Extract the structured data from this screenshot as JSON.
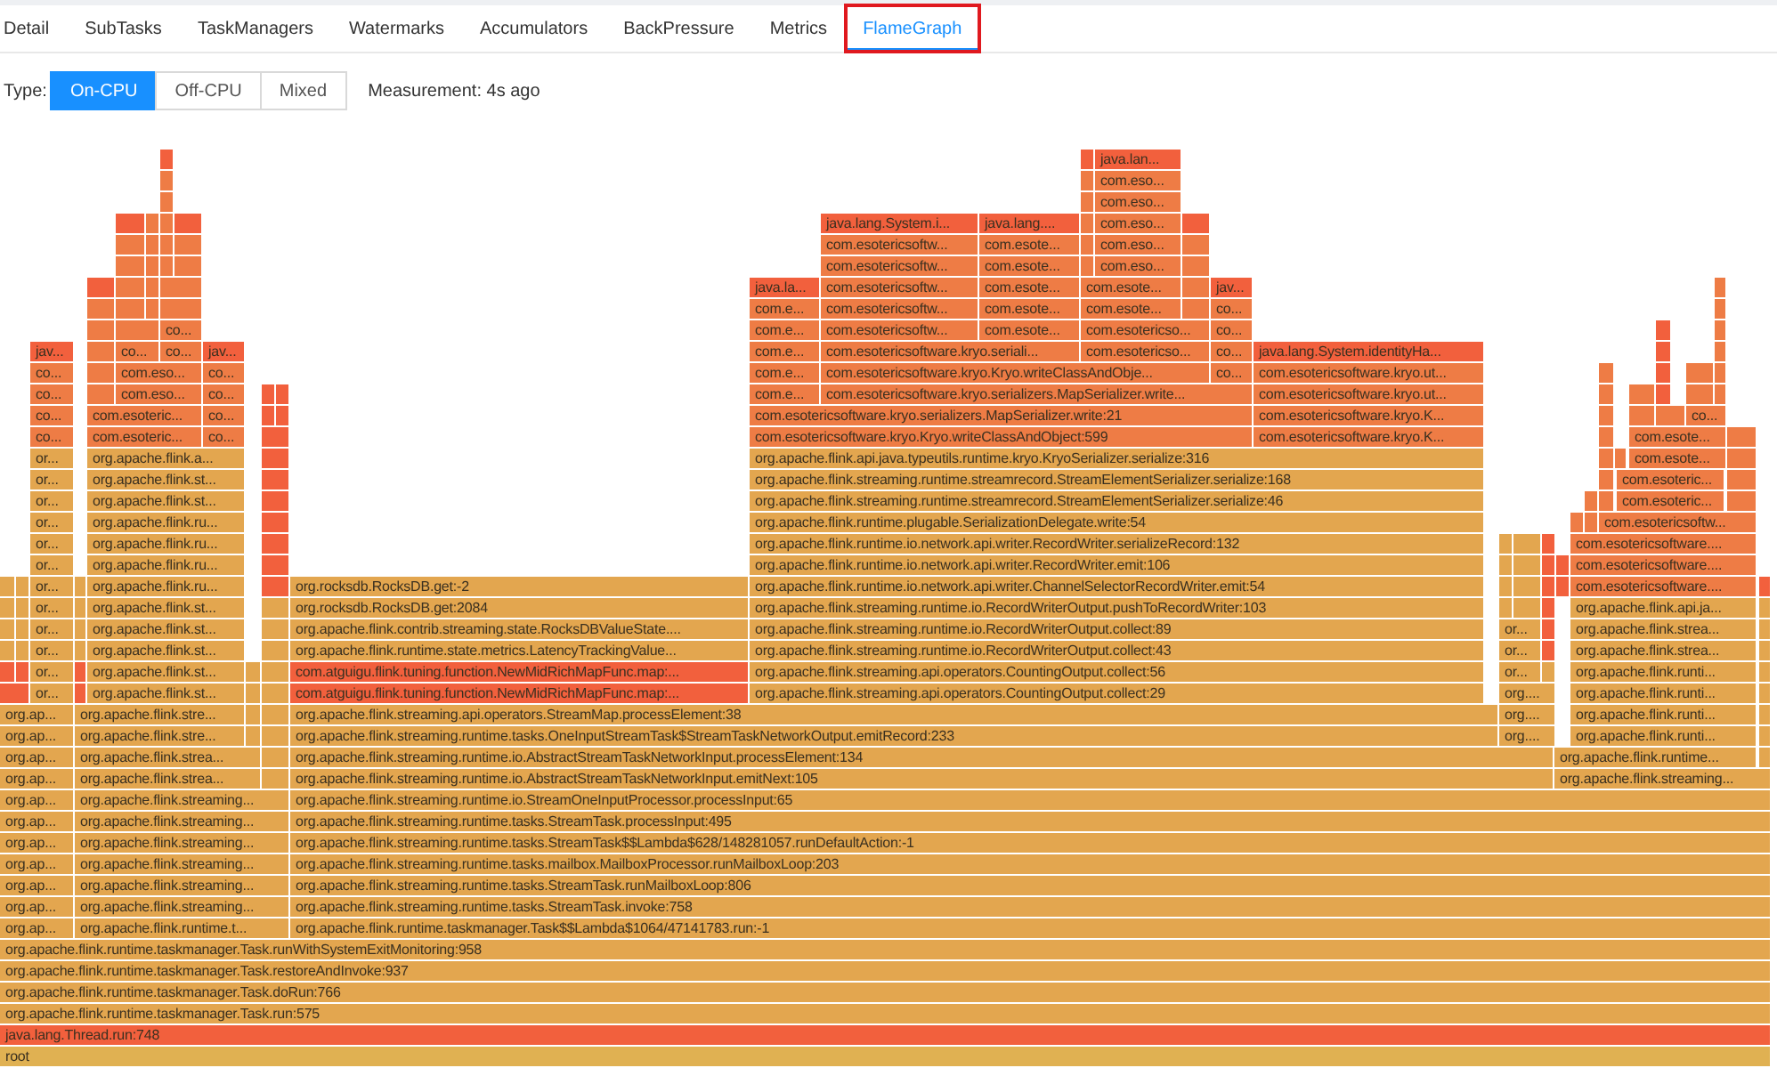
{
  "tabs": [
    {
      "label": "Detail",
      "selected": false,
      "highlighted": false
    },
    {
      "label": "SubTasks",
      "selected": false,
      "highlighted": false
    },
    {
      "label": "TaskManagers",
      "selected": false,
      "highlighted": false
    },
    {
      "label": "Watermarks",
      "selected": false,
      "highlighted": false
    },
    {
      "label": "Accumulators",
      "selected": false,
      "highlighted": false
    },
    {
      "label": "BackPressure",
      "selected": false,
      "highlighted": false
    },
    {
      "label": "Metrics",
      "selected": false,
      "highlighted": false
    },
    {
      "label": "FlameGraph",
      "selected": true,
      "highlighted": true
    }
  ],
  "type_filter": {
    "label": "Type:",
    "options": [
      {
        "label": "On-CPU",
        "selected": true
      },
      {
        "label": "Off-CPU",
        "selected": false
      },
      {
        "label": "Mixed",
        "selected": false
      }
    ]
  },
  "measurement": "Measurement: 4s ago",
  "flame_graph": {
    "frames": [
      {
        "color": "#f2603d"
      },
      {
        "color": "#f2603d"
      },
      {
        "label": "java.lan...",
        "color": "#f2603d"
      },
      {
        "color": "#ee7c45"
      },
      {
        "color": "#ee7c45"
      },
      {
        "label": "com.eso...",
        "color": "#ee7c45"
      },
      {
        "color": "#ee7c45"
      },
      {
        "color": "#ee7c45"
      },
      {
        "label": "com.eso...",
        "color": "#ee7c45"
      },
      {
        "color": "#f2603d"
      },
      {
        "color": "#ee7c45"
      },
      {
        "color": "#ee7c45"
      },
      {
        "color": "#f2603d"
      },
      {
        "label": "java.lang.System.i...",
        "color": "#f2603d"
      },
      {
        "label": "java.lang....",
        "color": "#f2603d"
      },
      {
        "color": "#ee7c45"
      },
      {
        "label": "com.eso...",
        "color": "#ee7c45"
      },
      {
        "color": "#f2603d"
      },
      {
        "color": "#ee7c45"
      },
      {
        "color": "#ee7c45"
      },
      {
        "color": "#ee7c45"
      },
      {
        "color": "#ee7c45"
      },
      {
        "label": "com.esotericsoftw...",
        "color": "#ee7c45"
      },
      {
        "label": "com.esote...",
        "color": "#ee7c45"
      },
      {
        "color": "#ee7c45"
      },
      {
        "label": "com.eso...",
        "color": "#ee7c45"
      },
      {
        "color": "#ee7c45"
      },
      {
        "color": "#ee7c45"
      },
      {
        "color": "#ee7c45"
      },
      {
        "color": "#ee7c45"
      },
      {
        "color": "#ee7c45"
      },
      {
        "label": "com.esotericsoftw...",
        "color": "#ee7c45"
      },
      {
        "label": "com.esote...",
        "color": "#ee7c45"
      },
      {
        "color": "#ee7c45"
      },
      {
        "label": "com.eso...",
        "color": "#ee7c45"
      },
      {
        "color": "#ee7c45"
      },
      {
        "color": "#f2603d"
      },
      {
        "color": "#ee7c45"
      },
      {
        "color": "#ee7c45"
      },
      {
        "color": "#ee7c45"
      },
      {
        "label": "java.la...",
        "color": "#f2603d"
      },
      {
        "label": "com.esotericsoftw...",
        "color": "#ee7c45"
      },
      {
        "label": "com.esote...",
        "color": "#ee7c45"
      },
      {
        "label": "com.esote...",
        "color": "#ee7c45"
      },
      {
        "color": "#ee7c45"
      },
      {
        "label": "jav...",
        "color": "#f2603d"
      },
      {
        "color": "#ee7c45"
      },
      {
        "color": "#ee7c45"
      },
      {
        "color": "#ee7c45"
      },
      {
        "color": "#ee7c45"
      },
      {
        "color": "#ee7c45"
      },
      {
        "label": "com.e...",
        "color": "#ee7c45"
      },
      {
        "label": "com.esotericsoftw...",
        "color": "#ee7c45"
      },
      {
        "label": "com.esote...",
        "color": "#ee7c45"
      },
      {
        "label": "com.esote...",
        "color": "#ee7c45"
      },
      {
        "color": "#ee7c45"
      },
      {
        "label": "co...",
        "color": "#ee7c45"
      },
      {
        "color": "#ee7c45"
      },
      {
        "color": "#ee7c45"
      },
      {
        "color": "#ee7c45"
      },
      {
        "label": "co...",
        "color": "#ee7c45"
      },
      {
        "label": "com.e...",
        "color": "#ee7c45"
      },
      {
        "label": "com.esotericsoftw...",
        "color": "#ee7c45"
      },
      {
        "label": "com.esote...",
        "color": "#ee7c45"
      },
      {
        "label": "com.esotericso...",
        "color": "#ee7c45"
      },
      {
        "label": "co...",
        "color": "#ee7c45"
      },
      {
        "color": "#f2603d"
      },
      {
        "color": "#ee7c45"
      },
      {
        "label": "jav...",
        "color": "#f2603d"
      },
      {
        "color": "#ee7c45"
      },
      {
        "label": "co...",
        "color": "#ee7c45"
      },
      {
        "label": "co...",
        "color": "#ee7c45"
      },
      {
        "label": "jav...",
        "color": "#f2603d"
      },
      {
        "label": "com.e...",
        "color": "#ee7c45"
      },
      {
        "label": "com.esotericsoftware.kryo.seriali...",
        "color": "#ee7c45"
      },
      {
        "label": "com.esotericso...",
        "color": "#ee7c45"
      },
      {
        "label": "co...",
        "color": "#ee7c45"
      },
      {
        "label": "java.lang.System.identityHa...",
        "color": "#f2603d"
      },
      {
        "color": "#f2603d"
      },
      {
        "color": "#ee7c45"
      },
      {
        "label": "co...",
        "color": "#ee7c45"
      },
      {
        "color": "#ee7c45"
      },
      {
        "label": "com.eso...",
        "color": "#ee7c45"
      },
      {
        "label": "co...",
        "color": "#ee7c45"
      },
      {
        "label": "com.e...",
        "color": "#ee7c45"
      },
      {
        "label": "com.esotericsoftware.kryo.Kryo.writeClassAndObje...",
        "color": "#ee7c45"
      },
      {
        "label": "co...",
        "color": "#ee7c45"
      },
      {
        "label": "com.esotericsoftware.kryo.ut...",
        "color": "#ee7c45"
      },
      {
        "color": "#ee7c45"
      },
      {
        "color": "#f2603d"
      },
      {
        "color": "#ee7c45"
      },
      {
        "color": "#ee7c45"
      },
      {
        "label": "co...",
        "color": "#ee7c45"
      },
      {
        "color": "#ee7c45"
      },
      {
        "label": "com.eso...",
        "color": "#ee7c45"
      },
      {
        "label": "co...",
        "color": "#ee7c45"
      },
      {
        "color": "#f2603d"
      },
      {
        "color": "#f2603d"
      },
      {
        "label": "com.e...",
        "color": "#ee7c45"
      },
      {
        "label": "com.esotericsoftware.kryo.serializers.MapSerializer.write...",
        "color": "#ee7c45"
      },
      {
        "label": "com.esotericsoftware.kryo.ut...",
        "color": "#ee7c45"
      },
      {
        "color": "#ee7c45"
      },
      {
        "color": "#ee7c45"
      },
      {
        "color": "#f2603d"
      },
      {
        "color": "#ee7c45"
      },
      {
        "color": "#ee7c45"
      },
      {
        "label": "co...",
        "color": "#ee7c45"
      },
      {
        "label": "com.esoteric...",
        "color": "#ee7c45"
      },
      {
        "label": "co...",
        "color": "#ee7c45"
      },
      {
        "color": "#f2603d"
      },
      {
        "color": "#f2603d"
      },
      {
        "label": "com.esotericsoftware.kryo.serializers.MapSerializer.write:21",
        "color": "#ee7c45"
      },
      {
        "label": "com.esotericsoftware.kryo.K...",
        "color": "#ee7c45"
      },
      {
        "color": "#ee7c45"
      },
      {
        "color": "#ee7c45"
      },
      {
        "color": "#ee7c45"
      },
      {
        "label": "co...",
        "color": "#ee7c45"
      },
      {
        "label": "co...",
        "color": "#ee7c45"
      },
      {
        "label": "com.esoteric...",
        "color": "#ee7c45"
      },
      {
        "label": "co...",
        "color": "#ee7c45"
      },
      {
        "color": "#f2603d"
      },
      {
        "label": "com.esotericsoftware.kryo.Kryo.writeClassAndObject:599",
        "color": "#ee7c45"
      },
      {
        "label": "com.esotericsoftware.kryo.K...",
        "color": "#ee7c45"
      },
      {
        "color": "#ee7c45"
      },
      {
        "label": "com.esote...",
        "color": "#ee7c45"
      },
      {
        "color": "#ee7c45"
      },
      {
        "label": "or...",
        "color": "#e3a64f"
      },
      {
        "label": "org.apache.flink.a...",
        "color": "#e3a64f"
      },
      {
        "color": "#f2603d"
      },
      {
        "label": "org.apache.flink.api.java.typeutils.runtime.kryo.KryoSerializer.serialize:316",
        "color": "#e3a64f"
      },
      {
        "color": "#ee7c45"
      },
      {
        "color": "#ee7c45"
      },
      {
        "label": "com.esote...",
        "color": "#ee7c45"
      },
      {
        "color": "#ee7c45"
      },
      {
        "label": "or...",
        "color": "#e3a64f"
      },
      {
        "label": "org.apache.flink.st...",
        "color": "#e3a64f"
      },
      {
        "color": "#f2603d"
      },
      {
        "label": "org.apache.flink.streaming.runtime.streamrecord.StreamElementSerializer.serialize:168",
        "color": "#e3a64f"
      },
      {
        "color": "#ee7c45"
      },
      {
        "label": "com.esoteric...",
        "color": "#ee7c45"
      },
      {
        "color": "#ee7c45"
      },
      {
        "label": "or...",
        "color": "#e3a64f"
      },
      {
        "label": "org.apache.flink.st...",
        "color": "#e3a64f"
      },
      {
        "color": "#f2603d"
      },
      {
        "label": "org.apache.flink.streaming.runtime.streamrecord.StreamElementSerializer.serialize:46",
        "color": "#e3a64f"
      },
      {
        "color": "#ee7c45"
      },
      {
        "color": "#ee7c45"
      },
      {
        "label": "com.esoteric...",
        "color": "#ee7c45"
      },
      {
        "color": "#ee7c45"
      },
      {
        "label": "or...",
        "color": "#e3a64f"
      },
      {
        "label": "org.apache.flink.ru...",
        "color": "#e3a64f"
      },
      {
        "color": "#f2603d"
      },
      {
        "label": "org.apache.flink.runtime.plugable.SerializationDelegate.write:54",
        "color": "#e3a64f"
      },
      {
        "color": "#ee7c45"
      },
      {
        "color": "#ee7c45"
      },
      {
        "label": "com.esotericsoftw...",
        "color": "#ee7c45"
      },
      {
        "label": "or...",
        "color": "#e3a64f"
      },
      {
        "label": "org.apache.flink.ru...",
        "color": "#e3a64f"
      },
      {
        "color": "#f2603d"
      },
      {
        "label": "org.apache.flink.runtime.io.network.api.writer.RecordWriter.serializeRecord:132",
        "color": "#e3a64f"
      },
      {
        "color": "#e3a64f"
      },
      {
        "color": "#e3a64f"
      },
      {
        "color": "#f2603d"
      },
      {
        "label": "com.esotericsoftware....",
        "color": "#ee7c45"
      },
      {
        "label": "or...",
        "color": "#e3a64f"
      },
      {
        "label": "org.apache.flink.ru...",
        "color": "#e3a64f"
      },
      {
        "color": "#f2603d"
      },
      {
        "label": "org.apache.flink.runtime.io.network.api.writer.RecordWriter.emit:106",
        "color": "#e3a64f"
      },
      {
        "color": "#e3a64f"
      },
      {
        "color": "#e3a64f"
      },
      {
        "color": "#f2603d"
      },
      {
        "color": "#f2603d"
      },
      {
        "label": "com.esotericsoftware....",
        "color": "#ee7c45"
      },
      {
        "color": "#e3a64f"
      },
      {
        "color": "#e3a64f"
      },
      {
        "label": "or...",
        "color": "#e3a64f"
      },
      {
        "color": "#e3a64f"
      },
      {
        "label": "org.apache.flink.ru...",
        "color": "#e3a64f"
      },
      {
        "color": "#f2603d"
      },
      {
        "label": "org.rocksdb.RocksDB.get:-2",
        "color": "#e3a64f"
      },
      {
        "label": "org.apache.flink.runtime.io.network.api.writer.ChannelSelectorRecordWriter.emit:54",
        "color": "#e3a64f"
      },
      {
        "color": "#e3a64f"
      },
      {
        "color": "#e3a64f"
      },
      {
        "color": "#f2603d"
      },
      {
        "color": "#f2603d"
      },
      {
        "label": "com.esotericsoftware....",
        "color": "#ee7c45"
      },
      {
        "color": "#f2603d"
      },
      {
        "color": "#e3a64f"
      },
      {
        "color": "#e3a64f"
      },
      {
        "label": "or...",
        "color": "#e3a64f"
      },
      {
        "color": "#e3a64f"
      },
      {
        "label": "org.apache.flink.st...",
        "color": "#e3a64f"
      },
      {
        "color": "#e3a64f"
      },
      {
        "label": "org.rocksdb.RocksDB.get:2084",
        "color": "#e3a64f"
      },
      {
        "label": "org.apache.flink.streaming.runtime.io.RecordWriterOutput.pushToRecordWriter:103",
        "color": "#e3a64f"
      },
      {
        "color": "#e3a64f"
      },
      {
        "color": "#e3a64f"
      },
      {
        "color": "#f2603d"
      },
      {
        "label": "org.apache.flink.api.ja...",
        "color": "#e3a64f"
      },
      {
        "color": "#e3a64f"
      },
      {
        "color": "#e3a64f"
      },
      {
        "color": "#e3a64f"
      },
      {
        "label": "or...",
        "color": "#e3a64f"
      },
      {
        "color": "#e3a64f"
      },
      {
        "label": "org.apache.flink.st...",
        "color": "#e3a64f"
      },
      {
        "color": "#e3a64f"
      },
      {
        "label": "org.apache.flink.contrib.streaming.state.RocksDBValueState....",
        "color": "#e3a64f"
      },
      {
        "label": "org.apache.flink.streaming.runtime.io.RecordWriterOutput.collect:89",
        "color": "#e3a64f"
      },
      {
        "label": "or...",
        "color": "#e3a64f"
      },
      {
        "color": "#f2603d"
      },
      {
        "label": "org.apache.flink.strea...",
        "color": "#e3a64f"
      },
      {
        "color": "#e3a64f"
      },
      {
        "color": "#e3a64f"
      },
      {
        "color": "#e3a64f"
      },
      {
        "label": "or...",
        "color": "#e3a64f"
      },
      {
        "color": "#e3a64f"
      },
      {
        "label": "org.apache.flink.st...",
        "color": "#e3a64f"
      },
      {
        "color": "#e3a64f"
      },
      {
        "label": "org.apache.flink.runtime.state.metrics.LatencyTrackingValue...",
        "color": "#e3a64f"
      },
      {
        "label": "org.apache.flink.streaming.runtime.io.RecordWriterOutput.collect:43",
        "color": "#e3a64f"
      },
      {
        "label": "or...",
        "color": "#e3a64f"
      },
      {
        "color": "#f2603d"
      },
      {
        "label": "org.apache.flink.strea...",
        "color": "#e3a64f"
      },
      {
        "color": "#e3a64f"
      },
      {
        "color": "#f2603d"
      },
      {
        "color": "#f2603d"
      },
      {
        "label": "or...",
        "color": "#e3a64f"
      },
      {
        "color": "#f2603d"
      },
      {
        "label": "org.apache.flink.st...",
        "color": "#e3a64f"
      },
      {
        "color": "#e3a64f"
      },
      {
        "color": "#e3a64f"
      },
      {
        "label": "com.atguigu.flink.tuning.function.NewMidRichMapFunc.map:...",
        "color": "#f2603d"
      },
      {
        "label": "org.apache.flink.streaming.api.operators.CountingOutput.collect:56",
        "color": "#e3a64f"
      },
      {
        "label": "or...",
        "color": "#e3a64f"
      },
      {
        "color": "#e3a64f"
      },
      {
        "label": "org.apache.flink.runti...",
        "color": "#e3a64f"
      },
      {
        "color": "#e3a64f"
      },
      {
        "color": "#f2603d"
      },
      {
        "label": "or...",
        "color": "#e3a64f"
      },
      {
        "color": "#f2603d"
      },
      {
        "label": "org.apache.flink.st...",
        "color": "#e3a64f"
      },
      {
        "color": "#e3a64f"
      },
      {
        "color": "#e3a64f"
      },
      {
        "label": "com.atguigu.flink.tuning.function.NewMidRichMapFunc.map:...",
        "color": "#f2603d"
      },
      {
        "label": "org.apache.flink.streaming.api.operators.CountingOutput.collect:29",
        "color": "#e3a64f"
      },
      {
        "label": "org....",
        "color": "#e3a64f"
      },
      {
        "label": "org.apache.flink.runti...",
        "color": "#e3a64f"
      },
      {
        "color": "#e3a64f"
      },
      {
        "label": "org.ap...",
        "color": "#e3a64f"
      },
      {
        "label": "org.apache.flink.stre...",
        "color": "#e3a64f"
      },
      {
        "color": "#e3a64f"
      },
      {
        "color": "#e3a64f"
      },
      {
        "label": "org.apache.flink.streaming.api.operators.StreamMap.processElement:38",
        "color": "#e3a64f"
      },
      {
        "label": "org....",
        "color": "#e3a64f"
      },
      {
        "label": "org.apache.flink.runti...",
        "color": "#e3a64f"
      },
      {
        "color": "#e3a64f"
      },
      {
        "label": "org.ap...",
        "color": "#e3a64f"
      },
      {
        "label": "org.apache.flink.stre...",
        "color": "#e3a64f"
      },
      {
        "color": "#e3a64f"
      },
      {
        "color": "#e3a64f"
      },
      {
        "label": "org.apache.flink.streaming.runtime.tasks.OneInputStreamTask$StreamTaskNetworkOutput.emitRecord:233",
        "color": "#e3a64f"
      },
      {
        "label": "org....",
        "color": "#e3a64f"
      },
      {
        "label": "org.apache.flink.runti...",
        "color": "#e3a64f"
      },
      {
        "color": "#e3a64f"
      },
      {
        "label": "org.ap...",
        "color": "#e3a64f"
      },
      {
        "label": "org.apache.flink.strea...",
        "color": "#e3a64f"
      },
      {
        "color": "#e3a64f"
      },
      {
        "label": "org.apache.flink.streaming.runtime.io.AbstractStreamTaskNetworkInput.processElement:134",
        "color": "#e3a64f"
      },
      {
        "label": "org.apache.flink.runtime...",
        "color": "#e3a64f"
      },
      {
        "color": "#e3a64f"
      },
      {
        "label": "org.ap...",
        "color": "#e3a64f"
      },
      {
        "label": "org.apache.flink.strea...",
        "color": "#e3a64f"
      },
      {
        "color": "#e3a64f"
      },
      {
        "label": "org.apache.flink.streaming.runtime.io.AbstractStreamTaskNetworkInput.emitNext:105",
        "color": "#e3a64f"
      },
      {
        "label": "org.apache.flink.streaming...",
        "color": "#e3a64f"
      },
      {
        "label": "org.ap...",
        "color": "#e3a64f"
      },
      {
        "label": "org.apache.flink.streaming...",
        "color": "#e3a64f"
      },
      {
        "label": "org.apache.flink.streaming.runtime.io.StreamOneInputProcessor.processInput:65",
        "color": "#e3a64f"
      },
      {
        "label": "org.ap...",
        "color": "#e3a64f"
      },
      {
        "label": "org.apache.flink.streaming...",
        "color": "#e3a64f"
      },
      {
        "label": "org.apache.flink.streaming.runtime.tasks.StreamTask.processInput:495",
        "color": "#e3a64f"
      },
      {
        "label": "org.ap...",
        "color": "#e3a64f"
      },
      {
        "label": "org.apache.flink.streaming...",
        "color": "#e3a64f"
      },
      {
        "label": "org.apache.flink.streaming.runtime.tasks.StreamTask$$Lambda$628/148281057.runDefaultAction:-1",
        "color": "#e3a64f"
      },
      {
        "label": "org.ap...",
        "color": "#e3a64f"
      },
      {
        "label": "org.apache.flink.streaming...",
        "color": "#e3a64f"
      },
      {
        "label": "org.apache.flink.streaming.runtime.tasks.mailbox.MailboxProcessor.runMailboxLoop:203",
        "color": "#e3a64f"
      },
      {
        "label": "org.ap...",
        "color": "#e3a64f"
      },
      {
        "label": "org.apache.flink.streaming...",
        "color": "#e3a64f"
      },
      {
        "label": "org.apache.flink.streaming.runtime.tasks.StreamTask.runMailboxLoop:806",
        "color": "#e3a64f"
      },
      {
        "label": "org.ap...",
        "color": "#e3a64f"
      },
      {
        "label": "org.apache.flink.streaming...",
        "color": "#e3a64f"
      },
      {
        "label": "org.apache.flink.streaming.runtime.tasks.StreamTask.invoke:758",
        "color": "#e3a64f"
      },
      {
        "label": "org.ap...",
        "color": "#e3a64f"
      },
      {
        "label": "org.apache.flink.runtime.t...",
        "color": "#e3a64f"
      },
      {
        "label": "org.apache.flink.runtime.taskmanager.Task$$Lambda$1064/47141783.run:-1",
        "color": "#e3a64f"
      },
      {
        "label": "org.apache.flink.runtime.taskmanager.Task.runWithSystemExitMonitoring:958",
        "color": "#e3a64f"
      },
      {
        "label": "org.apache.flink.runtime.taskmanager.Task.restoreAndInvoke:937",
        "color": "#e3a64f"
      },
      {
        "label": "org.apache.flink.runtime.taskmanager.Task.doRun:766",
        "color": "#e3a64f"
      },
      {
        "label": "org.apache.flink.runtime.taskmanager.Task.run:575",
        "color": "#e3a64f"
      },
      {
        "label": "java.lang.Thread.run:748",
        "color": "#f2603d"
      },
      {
        "label": "root",
        "color": "#e0b152"
      }
    ]
  }
}
